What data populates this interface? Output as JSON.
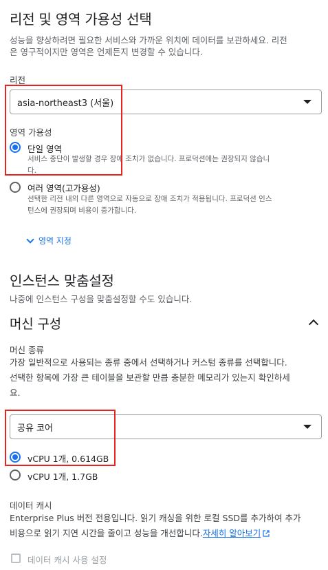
{
  "region_section": {
    "title": "리전 및 영역 가용성 선택",
    "description_line1": "성능을 향상하려면 필요한 서비스와 가까운 위치에 데이터를 보관하세요. 리전",
    "description_line2": "은 영구적이지만 영역은 언제든지 변경할 수 있습니다.",
    "region_label": "리전",
    "region_value": "asia-northeast3 (서울)",
    "zone_label": "영역 가용성",
    "options": [
      {
        "label": "단일 영역",
        "sub_line1": "서비스 중단이 발생할 경우 장애 조치가 없습니다. 프로덕션에는 권장되지 않습니",
        "sub_line2": "다.",
        "checked": true
      },
      {
        "label": "여러 영역(고가용성)",
        "sub_line1": "선택한 리전 내의 다른 영역으로 자동으로 장애 조치가 적용됩니다. 프로덕션 인스",
        "sub_line2": "턴스에 권장되며 비용이 증가합니다.",
        "checked": false
      }
    ],
    "specify_zone_link": "영역 지정"
  },
  "instance_section": {
    "title": "인스턴스 맞춤설정",
    "description": "나중에 인스턴스 구성을 맞춤설정할 수도 있습니다."
  },
  "machine_section": {
    "title": "머신 구성",
    "type_label": "머신 종류",
    "type_desc_line1": "가장 일반적으로 사용되는 종류 중에서 선택하거나 커스텀 종류를 선택합니다.",
    "type_desc_line2": "선택한 항목에 가장 큰 테이블을 보관할 만큼 충분한 메모리가 있는지 확인하세",
    "type_desc_line3": "요.",
    "type_value": "공유 코어",
    "options": [
      {
        "label": "vCPU 1개, 0.614GB",
        "checked": true
      },
      {
        "label": "vCPU 1개, 1.7GB",
        "checked": false
      }
    ]
  },
  "data_cache": {
    "title": "데이터 캐시",
    "desc_line1": "Enterprise Plus 버전 전용입니다. 읽기 캐싱을 위한 로컬 SSD를 추가하여 추가",
    "desc_line2": "비용으로 읽기 지연 시간을 줄이고 성능을 개선합니다.",
    "learn_more": "자세히 알아보기",
    "checkbox_label": "데이터 캐시 사용 설정"
  },
  "colors": {
    "accent": "#1a73e8",
    "highlight": "#e8221c"
  }
}
